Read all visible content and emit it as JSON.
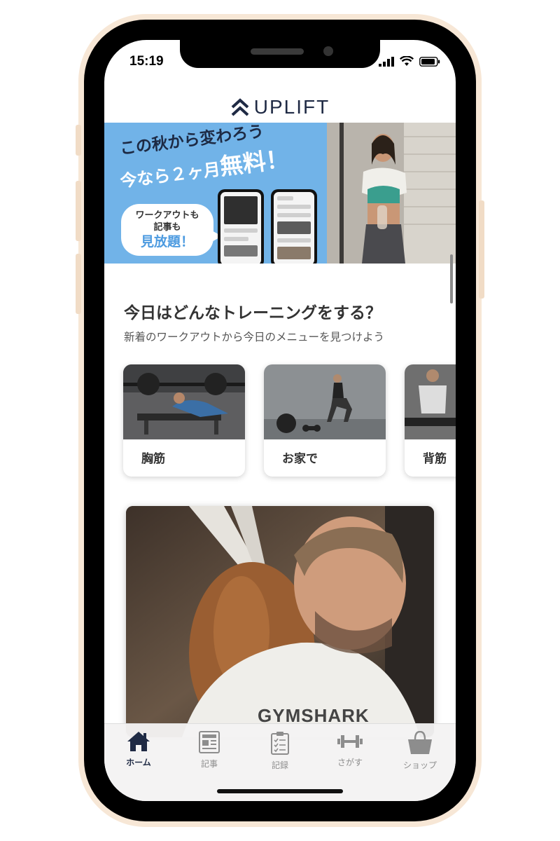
{
  "status_bar": {
    "time": "15:19"
  },
  "header": {
    "brand": "UPLIFT"
  },
  "banner": {
    "headline": "この秋から変わろう",
    "offer_prefix": "今なら２ヶ月",
    "offer_highlight": "無料！",
    "bubble": {
      "line1": "ワークアウトも",
      "line2": "記事も",
      "line3": "見放題！"
    }
  },
  "section": {
    "title": "今日はどんなトレーニングをする？",
    "subtitle": "新着のワークアウトから今日のメニューを見つけよう"
  },
  "categories": [
    {
      "label": "胸筋"
    },
    {
      "label": "お家で"
    },
    {
      "label": "背筋"
    }
  ],
  "feature": {
    "shirt_text": "GYMSHARK"
  },
  "tabbar": {
    "items": [
      {
        "label": "ホーム",
        "icon": "home-icon"
      },
      {
        "label": "記事",
        "icon": "article-icon"
      },
      {
        "label": "記録",
        "icon": "clipboard-icon"
      },
      {
        "label": "さがす",
        "icon": "dumbbell-icon"
      },
      {
        "label": "ショップ",
        "icon": "shopping-bag-icon"
      }
    ]
  },
  "colors": {
    "brand_navy": "#1f2a44",
    "banner_blue": "#71b3e8",
    "highlight_blue": "#4d9be0",
    "frame_beige": "#f7e7d6"
  }
}
